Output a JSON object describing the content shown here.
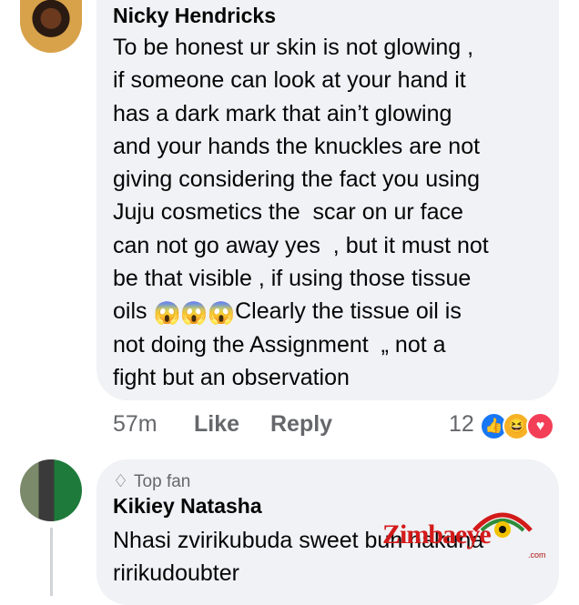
{
  "comment1": {
    "author": "Nicky Hendricks",
    "lines": [
      "To be honest ur skin is not glowing ,",
      "if someone can look at your hand it",
      "has a dark mark that ain’t glowing",
      "and your hands the knuckles are not",
      "giving considering the fact you using",
      "Juju cosmetics the  scar on ur face",
      "can not go away yes  , but it must not",
      "be that visible , if using those tissue"
    ],
    "line9_prefix": "oils ",
    "line9_emojis": "😱😱😱",
    "line9_suffix": "Clearly the tissue oil is",
    "lines_end": [
      "not doing the Assignment  „ not a",
      "fight but an observation"
    ],
    "time": "57m",
    "like_label": "Like",
    "reply_label": "Reply",
    "reaction_count": "12",
    "reactions": [
      "like-icon",
      "haha-icon",
      "love-icon"
    ]
  },
  "comment2": {
    "badge": "Top fan",
    "badge_icon": "diamond-icon",
    "author": "Kikiey Natasha",
    "lines": [
      "Nhasi zvirikubuda sweet buh hakuna",
      "ririkudoubter"
    ]
  },
  "watermark": {
    "text": "Zimbaeye",
    "dotcom": ".com"
  },
  "colors": {
    "bubble": "#f0f2f5",
    "meta": "#65676b",
    "like": "#1877f2",
    "haha": "#f7b125",
    "love": "#f33e58",
    "watermark": "#d31a1a"
  }
}
